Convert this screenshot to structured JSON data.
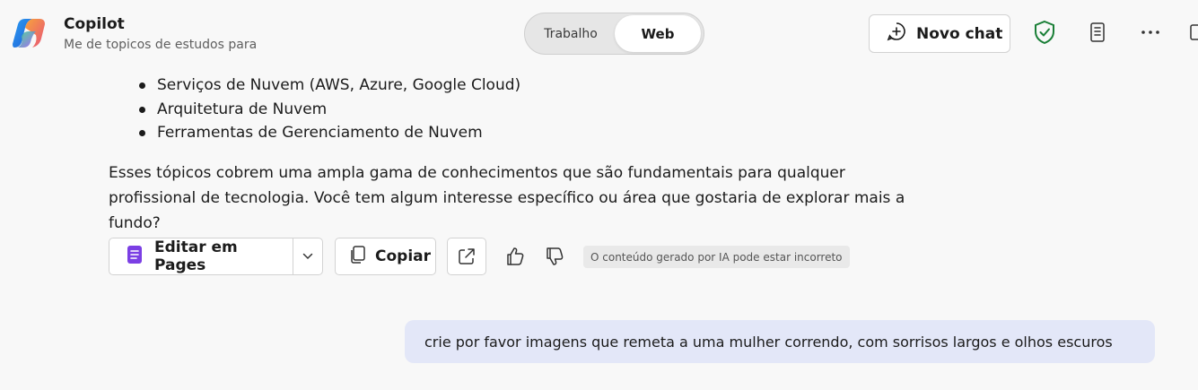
{
  "header": {
    "app_title": "Copilot",
    "subtitle": "Me de topicos de estudos para",
    "mode_toggle": {
      "options": [
        "Trabalho",
        "Web"
      ],
      "selected": "Web"
    },
    "new_chat_label": "Novo chat",
    "icons": [
      "copilot-logo-icon",
      "shield-check-icon",
      "notebook-icon",
      "more-icon",
      "side-panel-icon"
    ]
  },
  "response": {
    "list_items": [
      "Serviços de Nuvem (AWS, Azure, Google Cloud)",
      "Arquitetura de Nuvem",
      "Ferramentas de Gerenciamento de Nuvem"
    ],
    "paragraph": "Esses tópicos cobrem uma ampla gama de conhecimentos que são fundamentais para qualquer profissional de tecnologia. Você tem algum interesse específico ou área que gostaria de explorar mais a fundo?"
  },
  "actions": {
    "edit_label": "Editar em Pages",
    "copy_label": "Copiar",
    "disclaimer": "O conteúdo gerado por IA pode estar incorreto",
    "icons": [
      "pages-icon",
      "chevron-down-icon",
      "copy-icon",
      "share-icon",
      "thumbs-up-icon",
      "thumbs-down-icon"
    ]
  },
  "user_message": "crie por favor imagens que remeta a uma mulher correndo, com sorrisos largos e olhos escuros",
  "colors": {
    "background": "#f8f8f8",
    "user_bubble": "#e3e7f8",
    "shield_green": "#1a7f37",
    "pages_purple": "#7b3fe4"
  }
}
